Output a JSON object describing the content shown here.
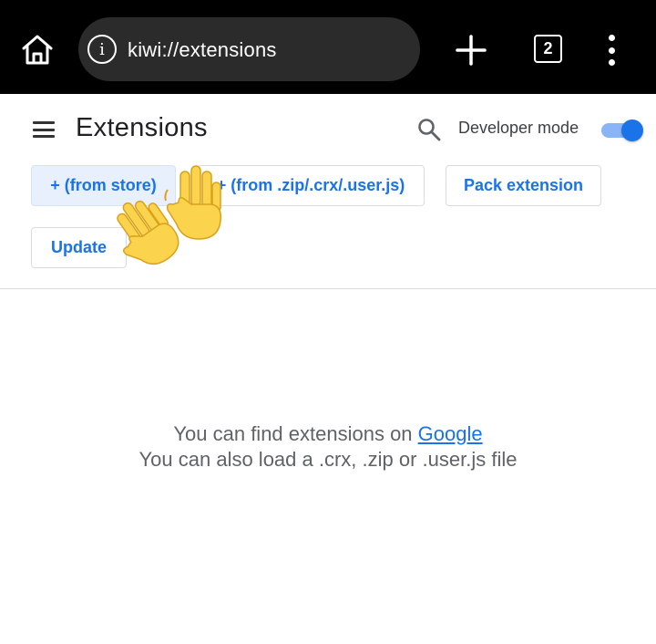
{
  "browser": {
    "url": "kiwi://extensions",
    "tab_count": "2",
    "icons": {
      "home": "home-icon",
      "info": "info-icon",
      "new_tab": "plus-icon",
      "menu": "more-vert-icon"
    }
  },
  "header": {
    "title": "Extensions",
    "developer_mode_label": "Developer mode",
    "developer_mode_enabled": true
  },
  "actions": {
    "from_store": "+ (from store)",
    "from_file": "+ (from .zip/.crx/.user.js)",
    "pack": "Pack extension",
    "update": "Update"
  },
  "empty_state": {
    "line1_prefix": "You can find extensions on ",
    "line1_link": "Google",
    "line2": "You can also load a .crx, .zip or .user.js file"
  },
  "colors": {
    "accent": "#1a73e8",
    "toolbar": "#000000",
    "omnibox": "#2b2b2b",
    "toggle_track": "#8ab4f8",
    "store_button_bg": "#e8f0fe"
  },
  "decorations": [
    "waving-hand-emoji",
    "waving-hand-emoji"
  ]
}
